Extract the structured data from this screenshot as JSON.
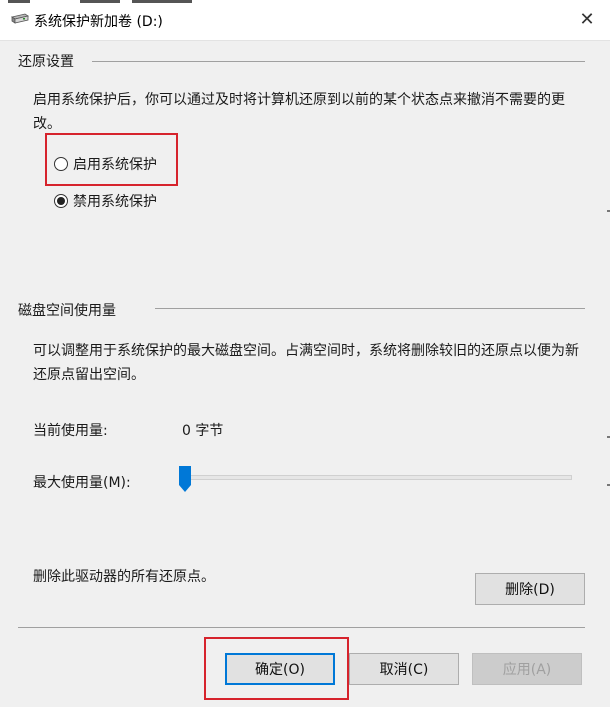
{
  "window": {
    "title": "系统保护新加卷 (D:)",
    "close_symbol": "✕"
  },
  "restore": {
    "heading": "还原设置",
    "description": "启用系统保护后，你可以通过及时将计算机还原到以前的某个状态点来撤消不需要的更改。",
    "options": [
      {
        "label": "启用系统保护",
        "selected": false
      },
      {
        "label": "禁用系统保护",
        "selected": true
      }
    ]
  },
  "disk": {
    "heading": "磁盘空间使用量",
    "description": "可以调整用于系统保护的最大磁盘空间。占满空间时，系统将删除较旧的还原点以便为新还原点留出空间。",
    "current_label": "当前使用量:",
    "current_value": "0 字节",
    "max_label": "最大使用量(M):",
    "max_usage_fraction": 0,
    "delete_text": "删除此驱动器的所有还原点。",
    "delete_button": "删除(D)"
  },
  "footer": {
    "ok": "确定(O)",
    "cancel": "取消(C)",
    "apply": "应用(A)"
  },
  "colors": {
    "highlight": "#d6232c",
    "focus_border": "#0078d7",
    "slider_thumb": "#0078d7"
  },
  "icons": {
    "drive": "drive-icon",
    "close": "close-icon"
  }
}
